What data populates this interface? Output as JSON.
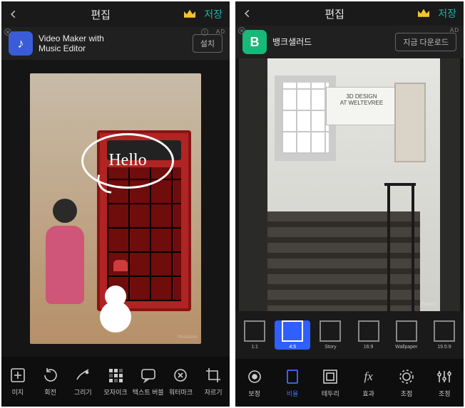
{
  "left": {
    "title": "편집",
    "save": "저장",
    "ad": {
      "name": "Video Maker with\nMusic Editor",
      "btn": "설치",
      "tag": "AD"
    },
    "bubble_text": "Hello",
    "sign_text": "",
    "watermark": "PhotoGrid",
    "tools": [
      {
        "label": "미지"
      },
      {
        "label": "회전"
      },
      {
        "label": "그리기"
      },
      {
        "label": "모자이크"
      },
      {
        "label": "텍스트 버블"
      },
      {
        "label": "워터마크"
      },
      {
        "label": "자르기"
      }
    ]
  },
  "right": {
    "title": "편집",
    "save": "저장",
    "ad": {
      "name": "뱅크샐러드",
      "btn": "지금 다운로드",
      "tag": "AD"
    },
    "sign_line1": "3D DESIGN",
    "sign_line2": "AT WELTEVREE",
    "watermark": "PhotoG",
    "ratios": [
      {
        "label": "1:1"
      },
      {
        "label": "4:5"
      },
      {
        "label": "Story"
      },
      {
        "label": "16:9"
      },
      {
        "label": "Wallpaper"
      },
      {
        "label": "19.5:9"
      }
    ],
    "tools": [
      {
        "label": "보정"
      },
      {
        "label": "비율"
      },
      {
        "label": "테두리"
      },
      {
        "label": "효과"
      },
      {
        "label": "초점"
      },
      {
        "label": "조정"
      }
    ]
  }
}
